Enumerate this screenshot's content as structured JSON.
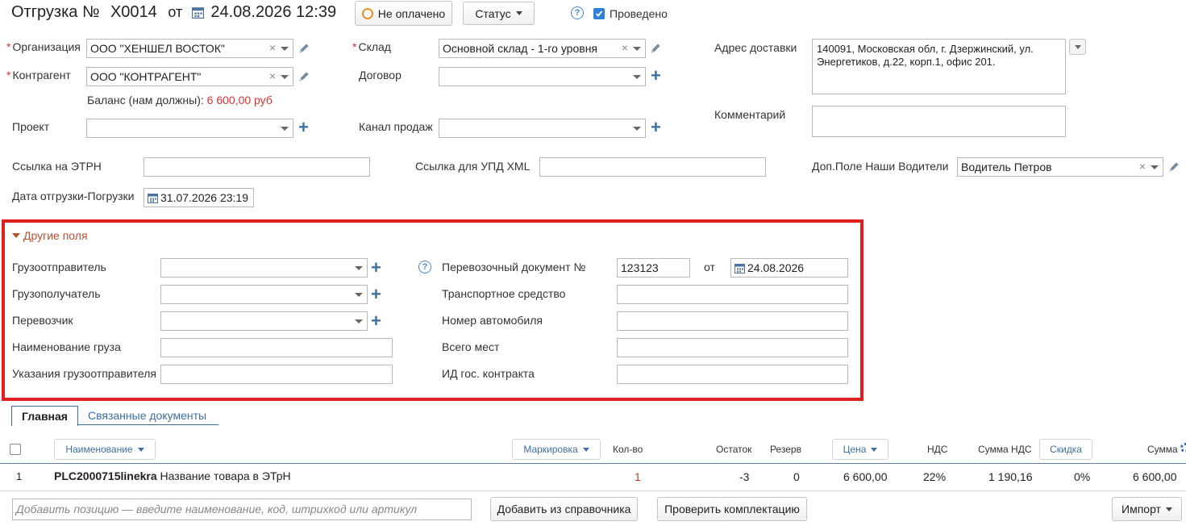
{
  "header": {
    "title_prefix": "Отгрузка №",
    "doc_number": "Х0014",
    "from_label": "от",
    "doc_date": "24.08.2026 12:39",
    "payment_status": "Не оплачено",
    "status_button": "Статус",
    "help": "?",
    "posted_label": "Проведено"
  },
  "form": {
    "organization_label": "Организация",
    "organization_value": "ООО \"ХЕНШЕЛ ВОСТОК\"",
    "counterparty_label": "Контрагент",
    "counterparty_value": "ООО \"КОНТРАГЕНТ\"",
    "balance_label": "Баланс (нам должны):",
    "balance_value": "6 600,00 руб",
    "project_label": "Проект",
    "warehouse_label": "Склад",
    "warehouse_value": "Основной склад - 1-го уровня",
    "contract_label": "Договор",
    "sales_channel_label": "Канал продаж",
    "delivery_address_label": "Адрес доставки",
    "delivery_address_value": "140091, Московская обл, г. Дзержинский,  ул. Энергетиков, д.22, корп.1, офис 201.",
    "comment_label": "Комментарий",
    "etrn_link_label": "Ссылка на ЭТРН",
    "upd_link_label": "Ссылка для УПД XML",
    "drivers_label": "Доп.Поле Наши Водители",
    "drivers_value": "Водитель Петров",
    "shipment_date_label": "Дата отгрузки-Погрузки",
    "shipment_date_value": "31.07.2026 23:19"
  },
  "other_fields": {
    "toggle_label": "Другие поля",
    "shipper_label": "Грузоотправитель",
    "consignee_label": "Грузополучатель",
    "carrier_label": "Перевозчик",
    "cargo_name_label": "Наименование груза",
    "shipper_instructions_label": "Указания грузоотправителя",
    "transport_doc_label": "Перевозочный документ №",
    "transport_doc_value": "123123",
    "from_label": "от",
    "transport_doc_date": "24.08.2026",
    "vehicle_label": "Транспортное средство",
    "car_number_label": "Номер автомобиля",
    "total_places_label": "Всего мест",
    "gov_contract_label": "ИД гос. контракта",
    "help": "?",
    "highlight_color": "#e02020"
  },
  "tabs": [
    {
      "label": "Главная"
    },
    {
      "label": "Связанные документы"
    }
  ],
  "table": {
    "headers": {
      "name": "Наименование",
      "marking": "Маркировка",
      "qty": "Кол-во",
      "stock": "Остаток",
      "reserve": "Резерв",
      "price": "Цена",
      "vat": "НДС",
      "vat_sum": "Сумма НДС",
      "discount": "Скидка",
      "sum": "Сумма"
    },
    "rows": [
      {
        "num": "1",
        "code": "PLC2000715linekra",
        "name": "Название товара в ЭТрН",
        "qty": "1",
        "stock": "-3",
        "reserve": "0",
        "price": "6 600,00",
        "vat": "22%",
        "vat_sum": "1 190,16",
        "discount": "0%",
        "sum": "6 600,00"
      }
    ]
  },
  "footer": {
    "add_placeholder": "Добавить позицию — введите наименование, код, штрихкод или артикул",
    "add_from_catalog": "Добавить из справочника",
    "check_kit": "Проверить комплектацию",
    "import": "Импорт"
  },
  "colors": {
    "accent": "#3d6fa3",
    "required": "#e03030",
    "balance": "#e03030",
    "status_ring": "#e8912b"
  }
}
